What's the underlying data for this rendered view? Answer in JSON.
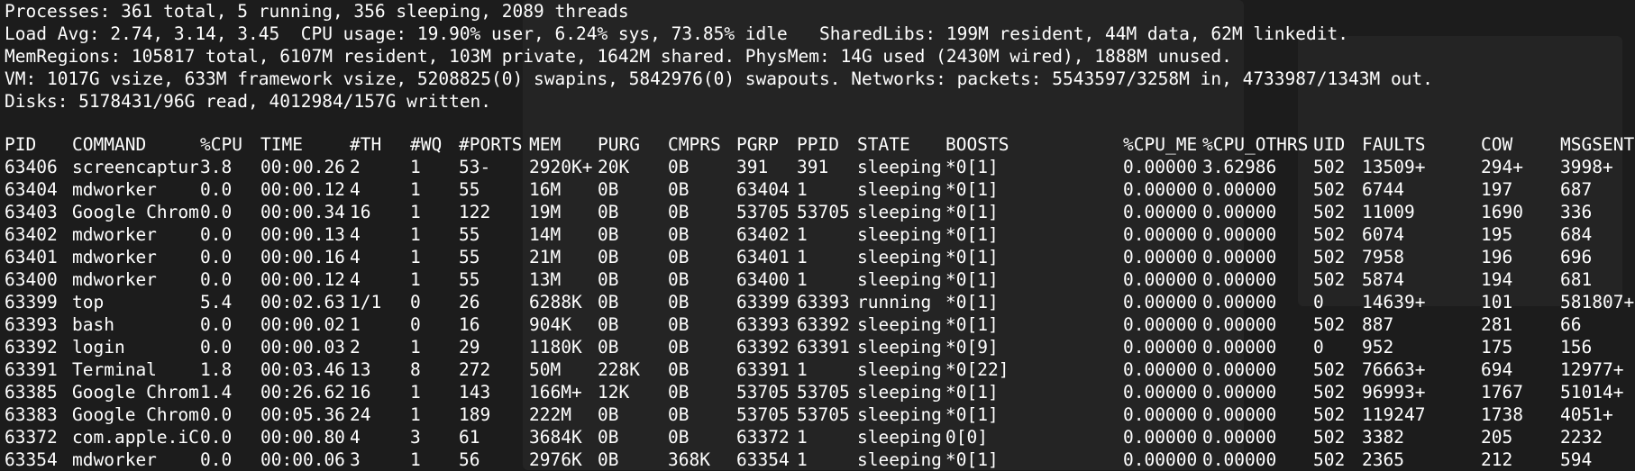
{
  "summary": {
    "processes": "Processes: 361 total, 5 running, 356 sleeping, 2089 threads",
    "load": "Load Avg: 2.74, 3.14, 3.45  CPU usage: 19.90% user, 6.24% sys, 73.85% idle   SharedLibs: 199M resident, 44M data, 62M linkedit.",
    "memregions": "MemRegions: 105817 total, 6107M resident, 103M private, 1642M shared. PhysMem: 14G used (2430M wired), 1888M unused.",
    "vm": "VM: 1017G vsize, 633M framework vsize, 5208825(0) swapins, 5842976(0) swapouts. Networks: packets: 5543597/3258M in, 4733987/1343M out.",
    "disks": "Disks: 5178431/96G read, 4012984/157G written."
  },
  "columns": [
    "PID",
    "COMMAND",
    "%CPU",
    "TIME",
    "#TH",
    "#WQ",
    "#PORTS",
    "MEM",
    "PURG",
    "CMPRS",
    "PGRP",
    "PPID",
    "STATE",
    "BOOSTS",
    "%CPU_ME",
    "%CPU_OTHRS",
    "UID",
    "FAULTS",
    "COW",
    "MSGSENT"
  ],
  "rows": [
    [
      "63406",
      "screencaptur",
      "3.8",
      "00:00.26",
      "2",
      "1",
      "53-",
      "2920K+",
      "20K",
      "0B",
      "391",
      "391",
      "sleeping",
      "*0[1]",
      "0.00000",
      "3.62986",
      "502",
      "13509+",
      "294+",
      "3998+"
    ],
    [
      "63404",
      "mdworker",
      "0.0",
      "00:00.12",
      "4",
      "1",
      "55",
      "16M",
      "0B",
      "0B",
      "63404",
      "1",
      "sleeping",
      "*0[1]",
      "0.00000",
      "0.00000",
      "502",
      "6744",
      "197",
      "687"
    ],
    [
      "63403",
      "Google Chrom",
      "0.0",
      "00:00.34",
      "16",
      "1",
      "122",
      "19M",
      "0B",
      "0B",
      "53705",
      "53705",
      "sleeping",
      "*0[1]",
      "0.00000",
      "0.00000",
      "502",
      "11009",
      "1690",
      "336"
    ],
    [
      "63402",
      "mdworker",
      "0.0",
      "00:00.13",
      "4",
      "1",
      "55",
      "14M",
      "0B",
      "0B",
      "63402",
      "1",
      "sleeping",
      "*0[1]",
      "0.00000",
      "0.00000",
      "502",
      "6074",
      "195",
      "684"
    ],
    [
      "63401",
      "mdworker",
      "0.0",
      "00:00.16",
      "4",
      "1",
      "55",
      "21M",
      "0B",
      "0B",
      "63401",
      "1",
      "sleeping",
      "*0[1]",
      "0.00000",
      "0.00000",
      "502",
      "7958",
      "196",
      "696"
    ],
    [
      "63400",
      "mdworker",
      "0.0",
      "00:00.12",
      "4",
      "1",
      "55",
      "13M",
      "0B",
      "0B",
      "63400",
      "1",
      "sleeping",
      "*0[1]",
      "0.00000",
      "0.00000",
      "502",
      "5874",
      "194",
      "681"
    ],
    [
      "63399",
      "top",
      "5.4",
      "00:02.63",
      "1/1",
      "0",
      "26",
      "6288K",
      "0B",
      "0B",
      "63399",
      "63393",
      "running",
      "*0[1]",
      "0.00000",
      "0.00000",
      "0",
      "14639+",
      "101",
      "581807+"
    ],
    [
      "63393",
      "bash",
      "0.0",
      "00:00.02",
      "1",
      "0",
      "16",
      "904K",
      "0B",
      "0B",
      "63393",
      "63392",
      "sleeping",
      "*0[1]",
      "0.00000",
      "0.00000",
      "502",
      "887",
      "281",
      "66"
    ],
    [
      "63392",
      "login",
      "0.0",
      "00:00.03",
      "2",
      "1",
      "29",
      "1180K",
      "0B",
      "0B",
      "63392",
      "63391",
      "sleeping",
      "*0[9]",
      "0.00000",
      "0.00000",
      "0",
      "952",
      "175",
      "156"
    ],
    [
      "63391",
      "Terminal",
      "1.8",
      "00:03.46",
      "13",
      "8",
      "272",
      "50M",
      "228K",
      "0B",
      "63391",
      "1",
      "sleeping",
      "*0[22]",
      "0.00000",
      "0.00000",
      "502",
      "76663+",
      "694",
      "12977+"
    ],
    [
      "63385",
      "Google Chrom",
      "1.4",
      "00:26.62",
      "16",
      "1",
      "143",
      "166M+",
      "12K",
      "0B",
      "53705",
      "53705",
      "sleeping",
      "*0[1]",
      "0.00000",
      "0.00000",
      "502",
      "96993+",
      "1767",
      "51014+"
    ],
    [
      "63383",
      "Google Chrom",
      "0.0",
      "00:05.36",
      "24",
      "1",
      "189",
      "222M",
      "0B",
      "0B",
      "53705",
      "53705",
      "sleeping",
      "*0[1]",
      "0.00000",
      "0.00000",
      "502",
      "119247",
      "1738",
      "4051+"
    ],
    [
      "63372",
      "com.apple.iC",
      "0.0",
      "00:00.80",
      "4",
      "3",
      "61",
      "3684K",
      "0B",
      "0B",
      "63372",
      "1",
      "sleeping",
      "0[0]",
      "0.00000",
      "0.00000",
      "502",
      "3382",
      "205",
      "2232"
    ],
    [
      "63354",
      "mdworker",
      "0.0",
      "00:00.06",
      "3",
      "1",
      "56",
      "2976K",
      "0B",
      "368K",
      "63354",
      "1",
      "sleeping",
      "*0[1]",
      "0.00000",
      "0.00000",
      "502",
      "2365",
      "212",
      "594"
    ]
  ]
}
